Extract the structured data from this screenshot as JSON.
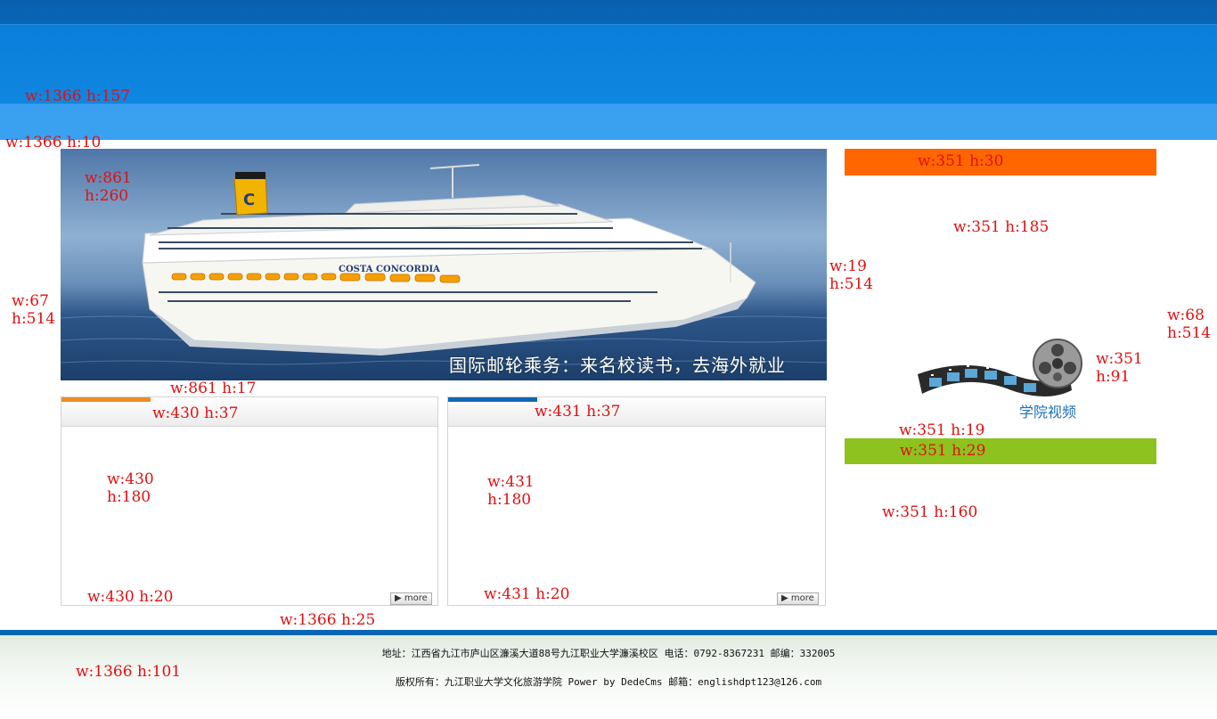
{
  "header": {
    "dim_header": "w:1366    h:157",
    "dim_spacer": "w:1366  h:10"
  },
  "banner": {
    "caption": "国际邮轮乘务：来名校读书，去海外就业",
    "ship_brand": "COSTA CONCORDIA",
    "funnel_logo": "C",
    "dim_size": "w:861\nh:260",
    "dim_below": "w:861  h:17"
  },
  "side_dims": {
    "left_margin": "w:67\nh:514",
    "gutter": "w:19\nh:514",
    "right_margin": "w:68\nh:514"
  },
  "box_left": {
    "dim_head": "w:430  h:37",
    "dim_body": "w:430\nh:180",
    "dim_foot": "w:430    h:20",
    "more_label": "more",
    "accent_color": "#f08a24"
  },
  "box_right": {
    "dim_head": "w:431   h:37",
    "dim_body": "w:431\nh:180",
    "dim_foot": "w:431   h:20",
    "more_label": "more",
    "accent_color": "#1565b5"
  },
  "sidebar": {
    "orange_bar_dim": "w:351  h:30",
    "orange_color": "#ff6600",
    "panel_dim": "w:351    h:185",
    "video_label": "学院视频",
    "video_dim": "w:351\nh:91",
    "spacer_dim": "w:351  h:19",
    "green_bar_dim": "w:351  h:29",
    "green_color": "#8dc21f",
    "bottom_dim": "w:351    h:160"
  },
  "footer": {
    "gap_dim": "w:1366  h:25",
    "address_line": "地址：江西省九江市庐山区濂溪大道88号九江职业大学濂溪校区 电话：0792-8367231 邮编：332005",
    "copyright_line": "版权所有：九江职业大学文化旅游学院 Power by DedeCms 邮箱：englishdpt123@126.com",
    "dim": "w:1366    h:101"
  }
}
